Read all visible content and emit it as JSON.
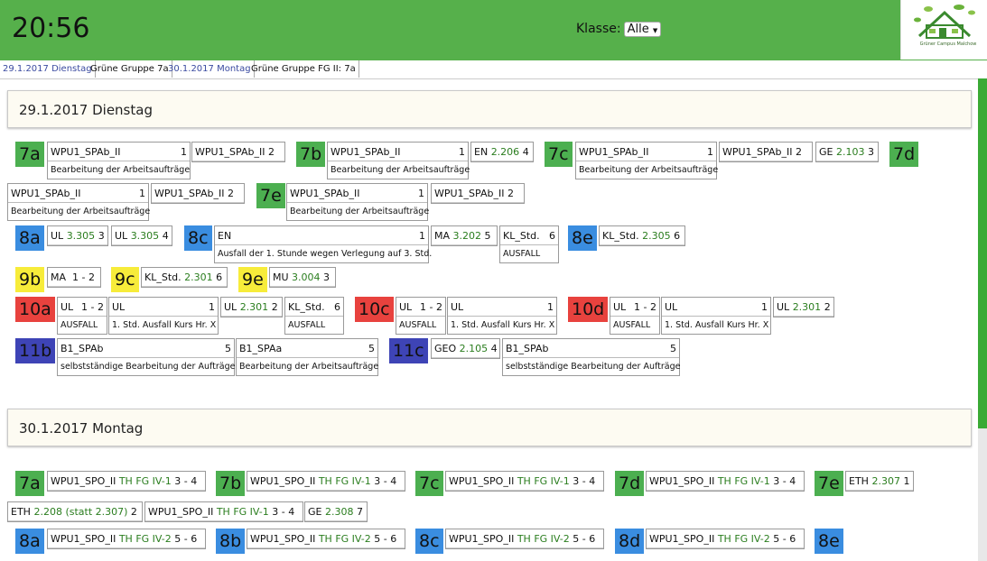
{
  "header": {
    "clock": "20:56",
    "klasse_label": "Klasse:",
    "klasse_value": "Alle",
    "logo_text": "Grüner Campus Malchow"
  },
  "tabs": [
    "29.1.2017 Dienstag",
    "Grüne Gruppe 7a",
    "30.1.2017 Montag",
    "Grüne Gruppe FG II: 7a"
  ],
  "day1": {
    "title": "29.1.2017 Dienstag",
    "classes": [
      "7a",
      "7b",
      "7c",
      "7d",
      "7e",
      "8a",
      "8c",
      "8e",
      "9b",
      "9c",
      "9e",
      "10a",
      "10c",
      "10d",
      "11b",
      "11c"
    ],
    "entries": [
      {
        "subject": "WPU1_SPAb_II",
        "room": "",
        "hour": "1",
        "note": "Bearbeitung der Arbeitsaufträge"
      },
      {
        "subject": "WPU1_SPAb_II",
        "room": "",
        "hour": "2",
        "note": ""
      },
      {
        "subject": "WPU1_SPAb_II",
        "room": "",
        "hour": "1",
        "note": "Bearbeitung der Arbeitsaufträge"
      },
      {
        "subject": "EN",
        "room": "2.206",
        "hour": "4",
        "note": ""
      },
      {
        "subject": "WPU1_SPAb_II",
        "room": "",
        "hour": "1",
        "note": "Bearbeitung der Arbeitsaufträge"
      },
      {
        "subject": "WPU1_SPAb_II",
        "room": "",
        "hour": "2",
        "note": ""
      },
      {
        "subject": "GE",
        "room": "2.103",
        "hour": "3",
        "note": ""
      },
      {
        "subject": "WPU1_SPAb_II",
        "room": "",
        "hour": "1",
        "note": "Bearbeitung der Arbeitsaufträge"
      },
      {
        "subject": "WPU1_SPAb_II",
        "room": "",
        "hour": "2",
        "note": ""
      },
      {
        "subject": "WPU1_SPAb_II",
        "room": "",
        "hour": "1",
        "note": "Bearbeitung der Arbeitsaufträge"
      },
      {
        "subject": "WPU1_SPAb_II",
        "room": "",
        "hour": "2",
        "note": ""
      },
      {
        "subject": "UL",
        "room": "3.305",
        "hour": "3",
        "note": ""
      },
      {
        "subject": "UL",
        "room": "3.305",
        "hour": "4",
        "note": ""
      },
      {
        "subject": "EN",
        "room": "",
        "hour": "1",
        "note": "Ausfall der 1. Stunde wegen Verlegung auf 3. Std."
      },
      {
        "subject": "MA",
        "room": "3.202",
        "hour": "5",
        "note": ""
      },
      {
        "subject": "KL_Std.",
        "room": "",
        "hour": "6",
        "note": "AUSFALL"
      },
      {
        "subject": "KL_Std.",
        "room": "2.305",
        "hour": "6",
        "note": ""
      },
      {
        "subject": "MA",
        "room": "",
        "hour": "1 - 2",
        "note": ""
      },
      {
        "subject": "KL_Std.",
        "room": "2.301",
        "hour": "6",
        "note": ""
      },
      {
        "subject": "MU",
        "room": "3.004",
        "hour": "3",
        "note": ""
      },
      {
        "subject": "UL",
        "room": "",
        "hour": "1 - 2",
        "note": "AUSFALL"
      },
      {
        "subject": "UL",
        "room": "",
        "hour": "1",
        "note": "1. Std. Ausfall Kurs Hr. X"
      },
      {
        "subject": "UL",
        "room": "2.301",
        "hour": "2",
        "note": ""
      },
      {
        "subject": "KL_Std.",
        "room": "",
        "hour": "6",
        "note": "AUSFALL"
      },
      {
        "subject": "UL",
        "room": "",
        "hour": "1 - 2",
        "note": "AUSFALL"
      },
      {
        "subject": "UL",
        "room": "",
        "hour": "1",
        "note": "1. Std. Ausfall Kurs Hr. X"
      },
      {
        "subject": "UL",
        "room": "",
        "hour": "1 - 2",
        "note": "AUSFALL"
      },
      {
        "subject": "UL",
        "room": "",
        "hour": "1",
        "note": "1. Std. Ausfall Kurs Hr. X"
      },
      {
        "subject": "UL",
        "room": "2.301",
        "hour": "2",
        "note": ""
      },
      {
        "subject": "B1_SPAb",
        "room": "",
        "hour": "5",
        "note": "selbstständige Bearbeitung der Aufträge"
      },
      {
        "subject": "B1_SPAa",
        "room": "",
        "hour": "5",
        "note": "Bearbeitung der Arbeitsaufträge"
      },
      {
        "subject": "GEO",
        "room": "2.105",
        "hour": "4",
        "note": ""
      },
      {
        "subject": "B1_SPAb",
        "room": "",
        "hour": "5",
        "note": "selbstständige Bearbeitung der Aufträge"
      }
    ]
  },
  "day2": {
    "title": "30.1.2017 Montag",
    "classes": [
      "7a",
      "7b",
      "7c",
      "7d",
      "7e",
      "8a",
      "8b",
      "8c",
      "8d",
      "8e"
    ],
    "entries": [
      {
        "subject": "WPU1_SPO_II",
        "teacher": "TH FG IV-1",
        "hour": "3 - 4"
      },
      {
        "subject": "WPU1_SPO_II",
        "teacher": "TH FG IV-1",
        "hour": "3 - 4"
      },
      {
        "subject": "WPU1_SPO_II",
        "teacher": "TH FG IV-1",
        "hour": "3 - 4"
      },
      {
        "subject": "WPU1_SPO_II",
        "teacher": "TH FG IV-1",
        "hour": "3 - 4"
      },
      {
        "subject": "ETH",
        "teacher": "2.307",
        "hour": "1"
      },
      {
        "subject": "ETH",
        "teacher": "2.208 (statt 2.307)",
        "hour": "2"
      },
      {
        "subject": "WPU1_SPO_II",
        "teacher": "TH FG IV-1",
        "hour": "3 - 4"
      },
      {
        "subject": "GE",
        "teacher": "2.308",
        "hour": "7"
      },
      {
        "subject": "WPU1_SPO_II",
        "teacher": "TH FG IV-2",
        "hour": "5 - 6"
      },
      {
        "subject": "WPU1_SPO_II",
        "teacher": "TH FG IV-2",
        "hour": "5 - 6"
      },
      {
        "subject": "WPU1_SPO_II",
        "teacher": "TH FG IV-2",
        "hour": "5 - 6"
      },
      {
        "subject": "WPU1_SPO_II",
        "teacher": "TH FG IV-2",
        "hour": "5 - 6"
      }
    ]
  },
  "colors": {
    "header": "#56b04b",
    "panel": "#fdfbf2",
    "room": "#2a7d1e"
  }
}
